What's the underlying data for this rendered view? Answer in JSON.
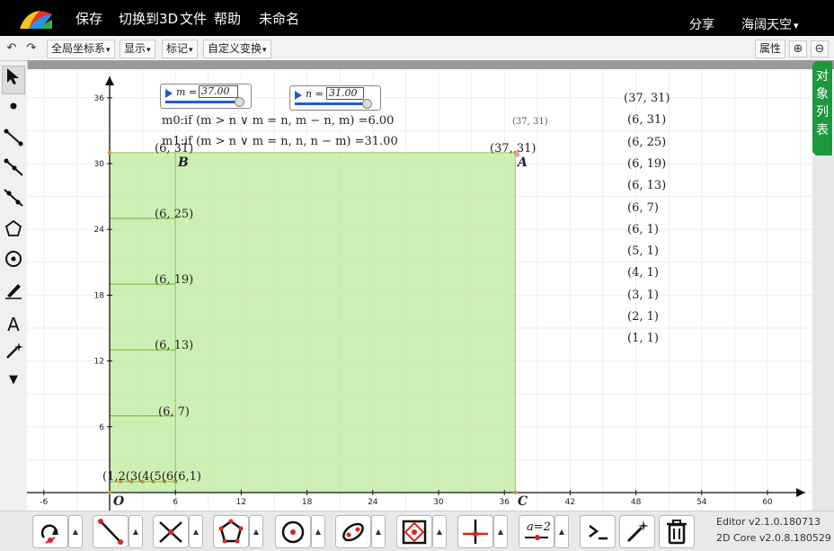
{
  "menu": {
    "save": "保存",
    "switch3d": "切换到3D",
    "file": "文件",
    "help": "帮助",
    "title": "未命名",
    "share": "分享",
    "user": "海阔天空"
  },
  "toolbar": {
    "coord": "全局坐标系",
    "show": "显示",
    "mark": "标记",
    "transform": "自定义变换",
    "props": "属性"
  },
  "object_tab": [
    "对",
    "象",
    "列",
    "表"
  ],
  "sliders": {
    "m": {
      "label": "m =",
      "value": "37.00",
      "fraction": 1.0
    },
    "n": {
      "label": "n =",
      "value": "31.00",
      "fraction": 0.97
    }
  },
  "formulas": {
    "m0": "m0:if (m > n ∨ m = n, m − n, m) =6.00",
    "m1": "m1:if (m > n ∨ m = n, n, n − m) =31.00"
  },
  "point_labels": {
    "A": "A",
    "B": "B",
    "C": "C",
    "O": "O",
    "A_coord": "(37, 31)",
    "A_coord_small": "(37, 31)",
    "B_coord": "(6, 31)"
  },
  "left_list": [
    "(6, 25)",
    "(6, 19)",
    "(6, 13)",
    "(6, 7)"
  ],
  "bottom_cluster": "(1,2(3(4(5(6(6,1)",
  "coord_list": [
    "(37, 31)",
    "(6, 31)",
    "(6, 25)",
    "(6, 19)",
    "(6, 13)",
    "(6, 7)",
    "(6, 1)",
    "(5, 1)",
    "(4, 1)",
    "(3, 1)",
    "(2, 1)",
    "(1, 1)"
  ],
  "axes": {
    "x_ticks": [
      "-6",
      "6",
      "12",
      "18",
      "24",
      "30",
      "36",
      "42",
      "48",
      "54",
      "60"
    ],
    "y_ticks": [
      "6",
      "12",
      "18",
      "24",
      "30",
      "36"
    ]
  },
  "colors": {
    "fill": "#b4e68c",
    "accent_blue": "#1f5bd6",
    "tab_green": "#1a9a3a"
  },
  "version": {
    "editor": "Editor v2.1.0.180713",
    "core": "2D Core v2.0.8.180529"
  },
  "bottom_tools_icon_names": [
    "move-around-icon",
    "segment-icon",
    "intersect-icon",
    "polygon-icon",
    "circle-icon",
    "ellipse-icon",
    "polygon-fill-icon",
    "perpendicular-icon",
    "slider-icon",
    "input-bar-icon",
    "magic-wand-icon",
    "trash-icon"
  ]
}
